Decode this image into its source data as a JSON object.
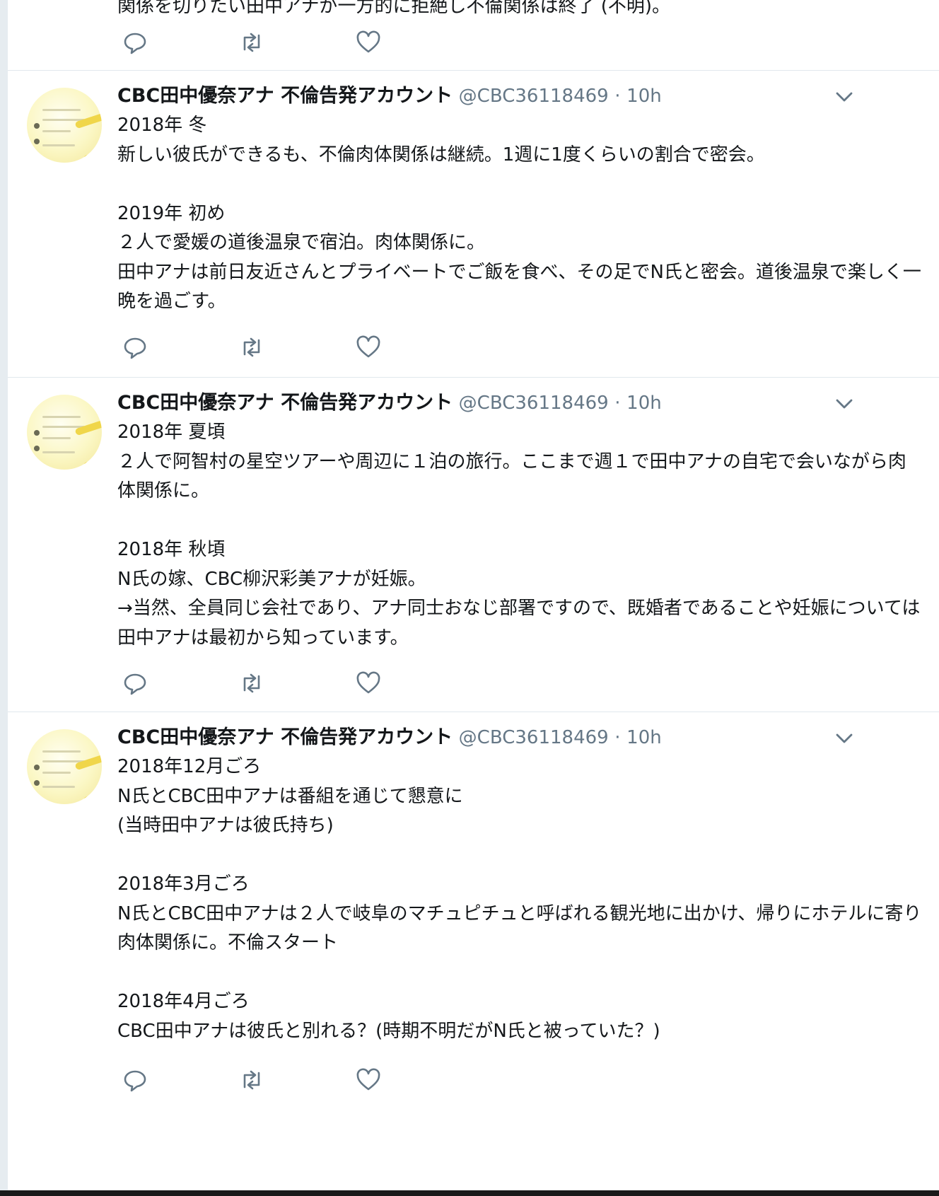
{
  "cut_tweet": {
    "text_fragment": "関係を切りたい田中アナが一方的に拒絶し不倫関係は終了 (不明)。"
  },
  "tweets": [
    {
      "name": "CBC田中優奈アナ 不倫告発アカウント",
      "handle": "@CBC36118469",
      "separator": "·",
      "time": "10h",
      "text": "2018年 冬\n新しい彼氏ができるも、不倫肉体関係は継続。1週に1度くらいの割合で密会。\n\n2019年 初め\n２人で愛媛の道後温泉で宿泊。肉体関係に。\n田中アナは前日友近さんとプライベートでご飯を食べ、その足でN氏と密会。道後温泉で楽しく一晩を過ごす。"
    },
    {
      "name": "CBC田中優奈アナ 不倫告発アカウント",
      "handle": "@CBC36118469",
      "separator": "·",
      "time": "10h",
      "text": "2018年 夏頃\n２人で阿智村の星空ツアーや周辺に１泊の旅行。ここまで週１で田中アナの自宅で会いながら肉体関係に。\n\n2018年 秋頃\nN氏の嫁、CBC柳沢彩美アナが妊娠。\n→当然、全員同じ会社であり、アナ同士おなじ部署ですので、既婚者であることや妊娠については田中アナは最初から知っています。"
    },
    {
      "name": "CBC田中優奈アナ 不倫告発アカウント",
      "handle": "@CBC36118469",
      "separator": "·",
      "time": "10h",
      "text": "2018年12月ごろ\nN氏とCBC田中アナは番組を通じて懇意に\n(当時田中アナは彼氏持ち)\n\n2018年3月ごろ\nN氏とCBC田中アナは２人で岐阜のマチュピチュと呼ばれる観光地に出かけ、帰りにホテルに寄り肉体関係に。不倫スタート\n\n2018年4月ごろ\nCBC田中アナは彼氏と別れる？(時期不明だがN氏と被っていた？)"
    }
  ],
  "icons": {
    "reply": "reply-icon",
    "retweet": "retweet-icon",
    "like": "heart-icon",
    "menu": "chevron-down-icon"
  },
  "colors": {
    "background": "#e6ecf0",
    "card": "#ffffff",
    "text": "#14171a",
    "secondary": "#657786",
    "border": "#e1e8ed"
  }
}
